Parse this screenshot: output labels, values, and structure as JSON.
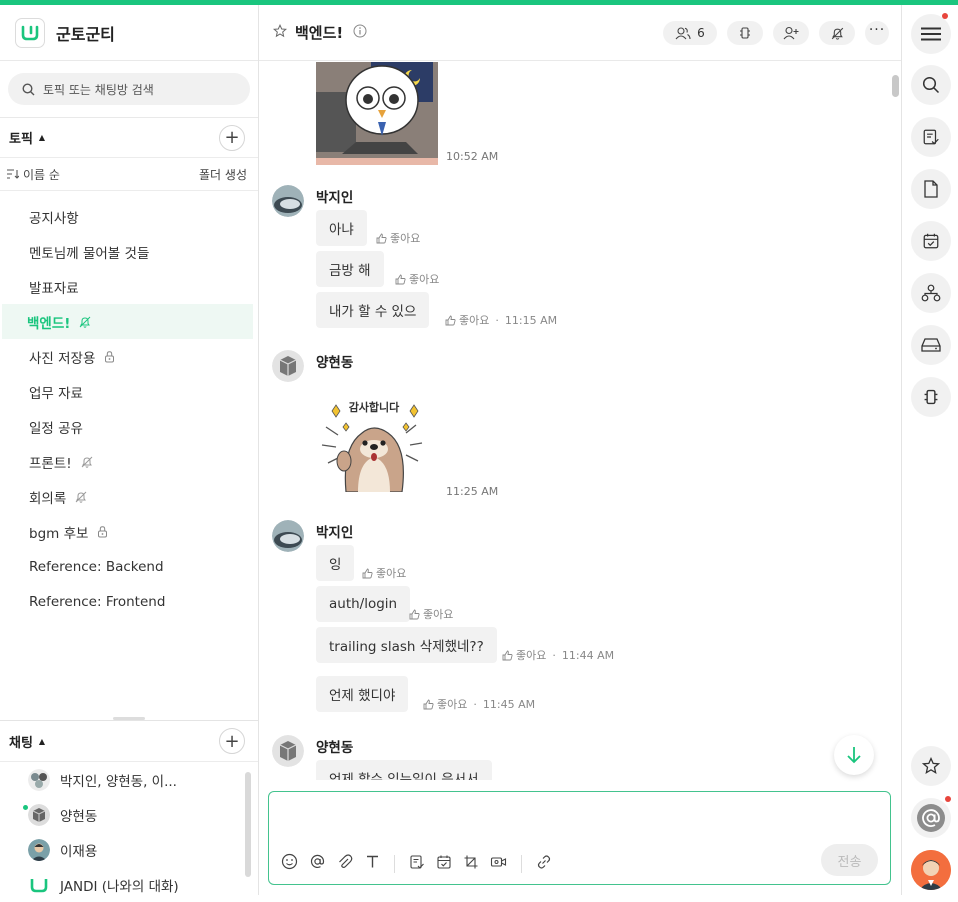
{
  "workspace": {
    "name": "군토군티"
  },
  "search": {
    "placeholder": "토픽 또는 채팅방 검색"
  },
  "topics_section": {
    "title": "토픽",
    "sort_label": "이름 순",
    "folder_label": "폴더 생성"
  },
  "topics": [
    {
      "label": "공지사항",
      "icon": ""
    },
    {
      "label": "멘토님께 물어볼 것들",
      "icon": ""
    },
    {
      "label": "발표자료",
      "icon": ""
    },
    {
      "label": "백엔드!",
      "icon": "bell-off-icon",
      "active": true
    },
    {
      "label": "사진 저장용",
      "icon": "lock-icon"
    },
    {
      "label": "업무 자료",
      "icon": ""
    },
    {
      "label": "일정 공유",
      "icon": ""
    },
    {
      "label": "프론트!",
      "icon": "bell-off-icon"
    },
    {
      "label": "회의록",
      "icon": "bell-off-icon"
    },
    {
      "label": "bgm 후보",
      "icon": "lock-icon"
    },
    {
      "label": "Reference: Backend",
      "icon": ""
    },
    {
      "label": "Reference: Frontend",
      "icon": ""
    }
  ],
  "chats_section": {
    "title": "채팅"
  },
  "chats": [
    {
      "label": "박지인, 양현동, 이..."
    },
    {
      "label": "양현동",
      "online": true
    },
    {
      "label": "이재용"
    },
    {
      "label": "JANDI (나와의 대화)"
    }
  ],
  "channel": {
    "title": "백엔드!",
    "member_count": "6"
  },
  "messages": {
    "like_label": "좋아요",
    "sticker1_time": "10:52 AM",
    "group1": {
      "sender": "박지인",
      "items": [
        {
          "text": "아냐"
        },
        {
          "text": "금방 해"
        },
        {
          "text": "내가 할 수 있으",
          "time": "11:15 AM"
        }
      ]
    },
    "group2": {
      "sender": "양현동",
      "sticker_text": "감사합니다",
      "time": "11:25 AM"
    },
    "group3": {
      "sender": "박지인",
      "items": [
        {
          "text": "잉"
        },
        {
          "text": "auth/login"
        },
        {
          "text": "trailing slash 삭제했네??",
          "time": "11:44 AM"
        },
        {
          "text": "언제 했디야",
          "time": "11:45 AM"
        }
      ]
    },
    "group4": {
      "sender": "양현동",
      "partial_text": "언제 할수 있는일이 음서서"
    }
  },
  "composer": {
    "send_label": "전송"
  },
  "colors": {
    "accent": "#1ac57e",
    "notification": "#e8453c"
  }
}
